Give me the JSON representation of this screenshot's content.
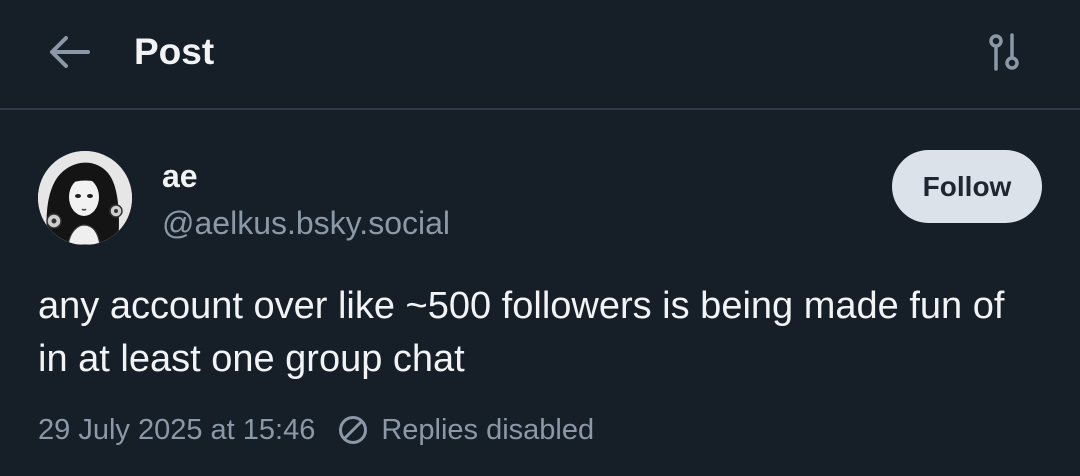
{
  "header": {
    "title": "Post",
    "back_icon": "arrow-left-icon",
    "filter_icon": "sliders-icon"
  },
  "post": {
    "author": {
      "display_name": "ae",
      "handle": "@aelkus.bsky.social"
    },
    "follow_label": "Follow",
    "text": "any account over like ~500 followers is being made fun of in at least one group chat",
    "timestamp": "29 July 2025 at 15:46",
    "replies_status": "Replies disabled",
    "replies_icon": "circle-slash-icon"
  },
  "colors": {
    "background": "#161e27",
    "divider": "#2e3a48",
    "text_primary": "#f1f3f5",
    "text_secondary": "#8b98a7",
    "follow_bg": "#dce2ea",
    "follow_text": "#1d2631"
  }
}
